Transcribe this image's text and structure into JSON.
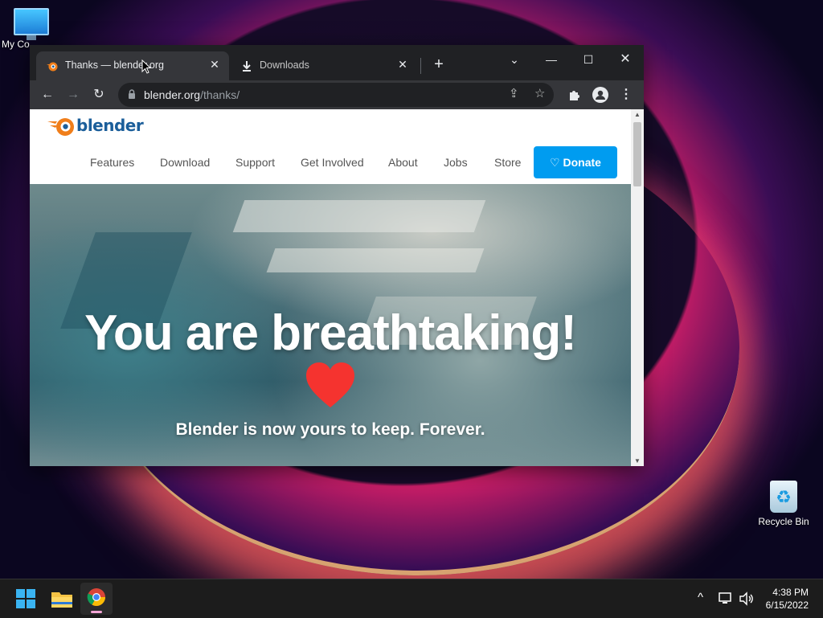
{
  "desktop": {
    "icons": [
      {
        "label": "My Co"
      },
      {
        "label": "Recycle Bin"
      }
    ]
  },
  "browser": {
    "tabs": [
      {
        "title": "Thanks — blender.org",
        "active": true,
        "icon": "blender-favicon"
      },
      {
        "title": "Downloads",
        "active": false,
        "icon": "download-icon"
      }
    ],
    "address": {
      "host": "blender.org",
      "path": "/thanks/"
    }
  },
  "site": {
    "logo_text": "blender",
    "nav": [
      "Features",
      "Download",
      "Support",
      "Get Involved",
      "About",
      "Jobs",
      "Store"
    ],
    "donate_label": "Donate",
    "hero_title": "You are breathtaking!",
    "hero_subtitle": "Blender is now yours to keep. Forever."
  },
  "taskbar": {
    "time": "4:38 PM",
    "date": "6/15/2022"
  },
  "colors": {
    "accent": "#009cf0",
    "heart": "#f5332f",
    "logo_orange": "#f07e1a",
    "logo_blue": "#1b5e9a"
  }
}
